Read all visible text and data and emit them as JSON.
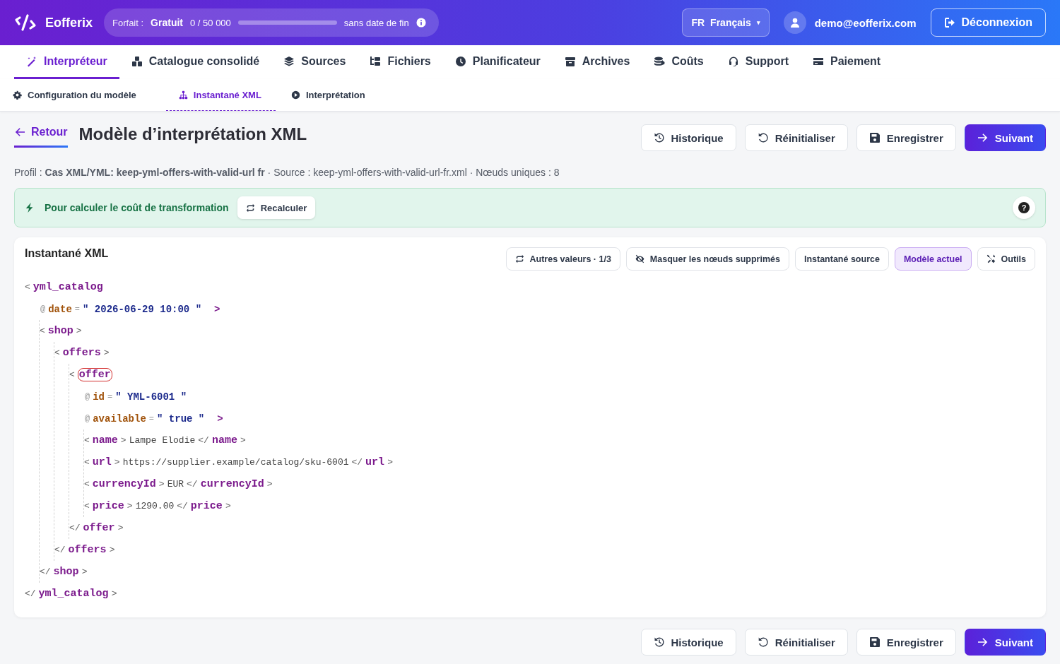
{
  "header": {
    "brand": "Eofferix",
    "plan": {
      "label": "Forfait :",
      "name": "Gratuit",
      "usage": "0 / 50 000",
      "expiry": "sans date de fin"
    },
    "language": {
      "code": "FR",
      "name": "Français",
      "caret": "▾"
    },
    "user": "demo@eofferix.com",
    "logout": "Déconnexion"
  },
  "tabs": [
    {
      "label": "Interpréteur",
      "selected": true
    },
    {
      "label": "Catalogue consolidé",
      "selected": false
    },
    {
      "label": "Sources",
      "selected": false
    },
    {
      "label": "Fichiers",
      "selected": false
    },
    {
      "label": "Planificateur",
      "selected": false
    },
    {
      "label": "Archives",
      "selected": false
    },
    {
      "label": "Coûts",
      "selected": false
    },
    {
      "label": "Support",
      "selected": false
    },
    {
      "label": "Paiement",
      "selected": false
    }
  ],
  "subtabs": [
    {
      "label": "Configuration du modèle",
      "selected": false
    },
    {
      "label": "Instantané XML",
      "selected": true
    },
    {
      "label": "Interprétation",
      "selected": false
    }
  ],
  "back": "Retour",
  "title": "Modèle d’interprétation XML",
  "actions": [
    "Historique",
    "Réinitialiser",
    "Enregistrer",
    "Suivant"
  ],
  "bottom_actions": [
    "Historique",
    "Réinitialiser",
    "Enregistrer",
    "Suivant"
  ],
  "profile": "Profil : **Cas XML/YML: keep-yml-offers-with-valid-url fr** · Source : keep-yml-offers-with-valid-url-fr.xml · Nœuds uniques : 8",
  "notice": {
    "text": "Pour calculer le coût de transformation",
    "button": "Recalculer",
    "help": "?"
  },
  "snapshot": {
    "title": "Instantané XML",
    "tools": [
      {
        "label": "Autres valeurs · 1/3",
        "selected": false
      },
      {
        "label": "Masquer les nœuds supprimés",
        "selected": false
      },
      {
        "label": "Instantané source",
        "selected": false
      },
      {
        "label": "Modèle actuel",
        "selected": true
      },
      {
        "label": "Outils",
        "selected": false
      }
    ],
    "syntax": {
      "open": "<",
      "close": ">",
      "end": "</",
      "at": "@",
      "eq": "=",
      "quote": "\""
    },
    "root": {
      "tag": "yml_catalog",
      "close_tag": "yml_catalog",
      "flagged": false,
      "attributes": [
        {
          "name": "date",
          "value": "2026-06-29 10:00"
        }
      ],
      "children": [
        {
          "tag": "shop",
          "close_tag": "shop",
          "flagged": false,
          "children": [
            {
              "tag": "offers",
              "close_tag": "offers",
              "flagged": false,
              "children": [
                {
                  "tag": "offer",
                  "close_tag": "offer",
                  "flagged": true,
                  "attributes": [
                    {
                      "name": "id",
                      "value": "YML-6001"
                    },
                    {
                      "name": "available",
                      "value": "true"
                    }
                  ],
                  "children": [
                    {
                      "tag": "name",
                      "close_tag": "name",
                      "flagged": false,
                      "text": "Lampe Elodie"
                    },
                    {
                      "tag": "url",
                      "close_tag": "url",
                      "flagged": false,
                      "text": "https://supplier.example/catalog/sku-6001"
                    },
                    {
                      "tag": "currencyId",
                      "close_tag": "currencyId",
                      "flagged": false,
                      "text": "EUR"
                    },
                    {
                      "tag": "price",
                      "close_tag": "price",
                      "flagged": false,
                      "text": "1290.00"
                    }
                  ]
                }
              ]
            }
          ]
        }
      ]
    }
  }
}
